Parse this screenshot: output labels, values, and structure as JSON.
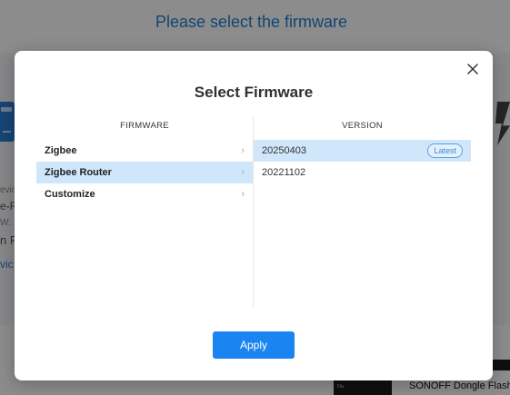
{
  "background": {
    "page_title": "Please select the firmware",
    "fragments": [
      "evic",
      "e-R",
      "W:",
      "n Fl",
      "vic"
    ],
    "taskbar_label": "SONOFF Dongle Flasher",
    "thumbnail_text": "Fla"
  },
  "modal": {
    "title": "Select Firmware",
    "close_icon": "close-icon",
    "firmware_header": "FIRMWARE",
    "version_header": "VERSION",
    "firmware_items": [
      {
        "label": "Zigbee",
        "selected": false
      },
      {
        "label": "Zigbee Router",
        "selected": true
      },
      {
        "label": "Customize",
        "selected": false
      }
    ],
    "chevron": "›",
    "versions": [
      {
        "label": "20250403",
        "badge": "Latest",
        "selected": true
      },
      {
        "label": "20221102",
        "badge": "",
        "selected": false
      }
    ],
    "apply_label": "Apply"
  },
  "colors": {
    "accent": "#1a84f0",
    "selected_row": "#cfe6fb",
    "title_blue": "#1f7fd0"
  }
}
